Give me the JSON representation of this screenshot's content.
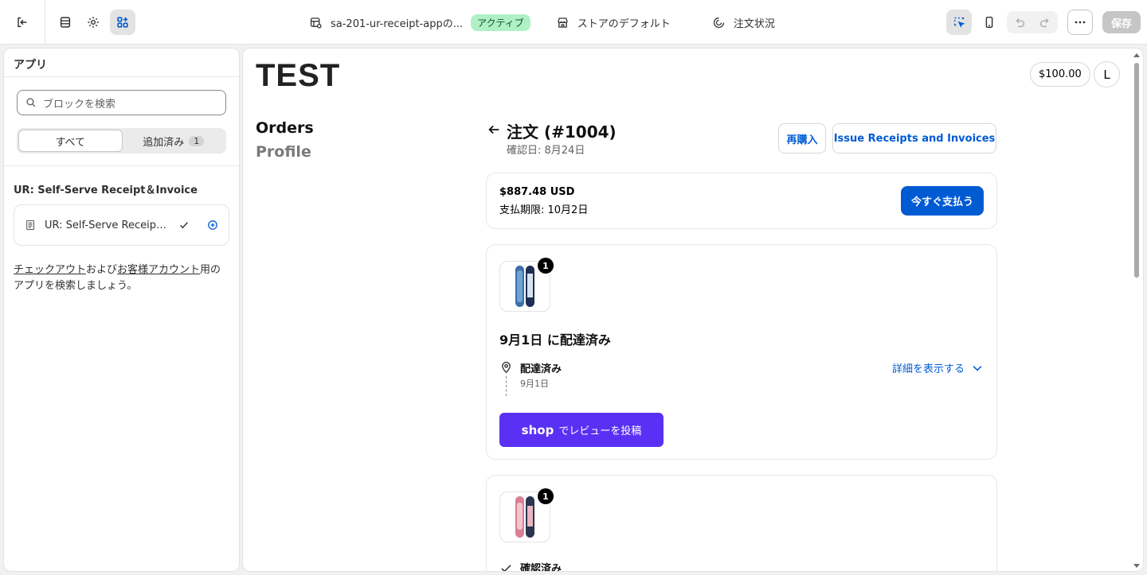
{
  "topbar": {
    "theme_name": "sa-201-ur-receipt-appの...",
    "status_badge": "アクティブ",
    "store_default": "ストアのデフォルト",
    "order_status": "注文状況",
    "save_label": "保存"
  },
  "left_panel": {
    "title": "アプリ",
    "search_placeholder": "ブロックを検索",
    "tab_all": "すべて",
    "tab_added": "追加済み",
    "tab_added_count": "1",
    "section_title": "UR: Self-Serve Receipt＆Invoice",
    "block_label": "UR: Self-Serve Receipt & Invoice",
    "help_link1": "チェックアウト",
    "help_text1": "および",
    "help_link2": "お客様アカウント",
    "help_text2": "用のアプリを検索しましょう。"
  },
  "preview": {
    "logo": "TEST",
    "balance": "$100.00",
    "avatar_initial": "L",
    "nav": {
      "orders": "Orders",
      "profile": "Profile"
    },
    "order": {
      "title": "注文 (#1004)",
      "confirmed": "確認日: 8月24日",
      "reorder_label": "再購入",
      "receipts_label": "Issue Receipts and Invoices"
    },
    "payment": {
      "amount": "$887.48 USD",
      "due": "支払期限: 10月2日",
      "pay_now_label": "今すぐ支払う"
    },
    "fulfillment1": {
      "quantity": "1",
      "title": "9月1日 に配達済み",
      "status": "配達済み",
      "status_date": "9月1日",
      "details_label": "詳細を表示する",
      "shop_logo": "shop",
      "review_label": "でレビューを投稿"
    },
    "fulfillment2": {
      "quantity": "1",
      "status": "確認済み"
    }
  },
  "colors": {
    "accent": "#005bd3",
    "shop_purple": "#5a31f4",
    "badge_green": "#aff0c5"
  }
}
